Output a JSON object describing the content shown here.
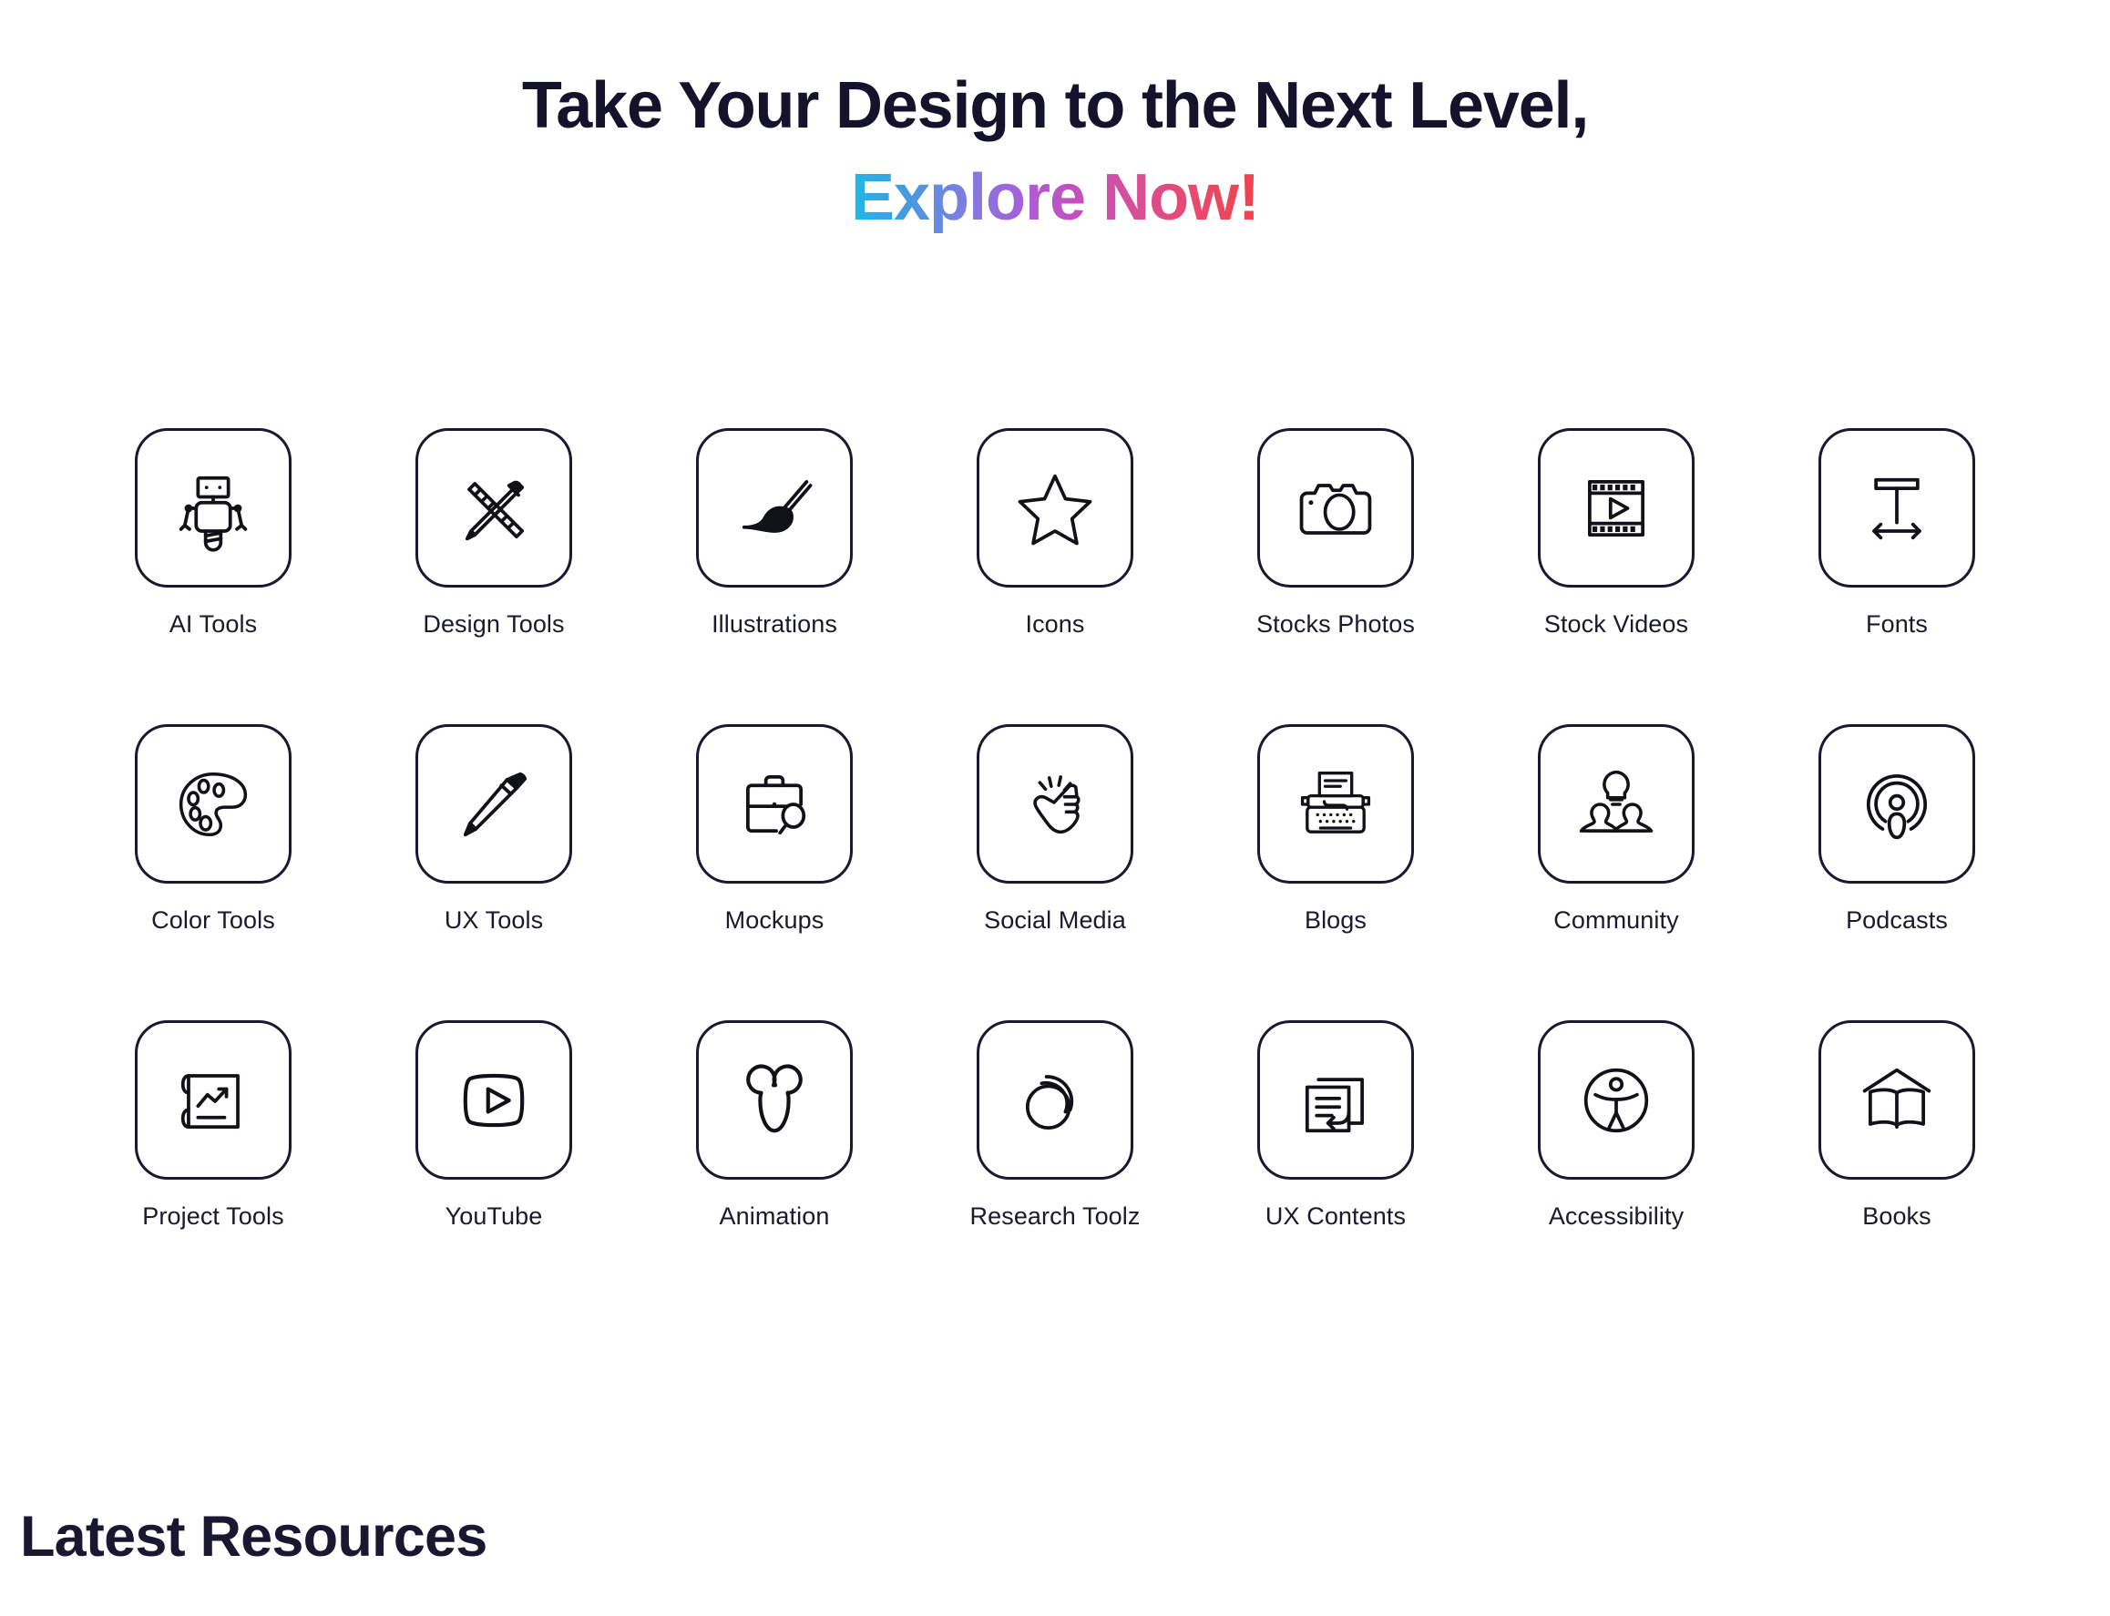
{
  "hero": {
    "line1": "Take Your Design to the Next Level,",
    "line2": "Explore Now!",
    "gradient": {
      "start": "#21b6e8",
      "mid1": "#7b7fe0",
      "mid2": "#a75fd8",
      "mid3": "#d64f9d",
      "end": "#f0444a"
    },
    "title_color": "#14132b"
  },
  "categories": {
    "rows": [
      [
        {
          "label": "AI Tools",
          "icon": "robot-icon"
        },
        {
          "label": "Design Tools",
          "icon": "ruler-pencil-icon"
        },
        {
          "label": "Illustrations",
          "icon": "paintbrush-icon"
        },
        {
          "label": "Icons",
          "icon": "star-icon"
        },
        {
          "label": "Stocks Photos",
          "icon": "camera-icon"
        },
        {
          "label": "Stock Videos",
          "icon": "film-play-icon"
        },
        {
          "label": "Fonts",
          "icon": "typography-icon"
        }
      ],
      [
        {
          "label": "Color Tools",
          "icon": "palette-icon"
        },
        {
          "label": "UX Tools",
          "icon": "pencil-icon"
        },
        {
          "label": "Mockups",
          "icon": "briefcase-search-icon"
        },
        {
          "label": "Social Media",
          "icon": "tap-hand-icon"
        },
        {
          "label": "Blogs",
          "icon": "typewriter-icon"
        },
        {
          "label": "Community",
          "icon": "people-idea-icon"
        },
        {
          "label": "Podcasts",
          "icon": "podcast-icon"
        }
      ],
      [
        {
          "label": "Project Tools",
          "icon": "blueprint-chart-icon"
        },
        {
          "label": "YouTube",
          "icon": "youtube-play-icon"
        },
        {
          "label": "Animation",
          "icon": "mouse-head-icon"
        },
        {
          "label": "Research Toolz",
          "icon": "stacked-circles-icon"
        },
        {
          "label": "UX Contents",
          "icon": "documents-arrow-icon"
        },
        {
          "label": "Accessibility",
          "icon": "accessibility-icon"
        },
        {
          "label": "Books",
          "icon": "open-book-icon"
        }
      ]
    ]
  },
  "section": {
    "latest_resources_title": "Latest Resources",
    "title_color": "#1a1730"
  }
}
